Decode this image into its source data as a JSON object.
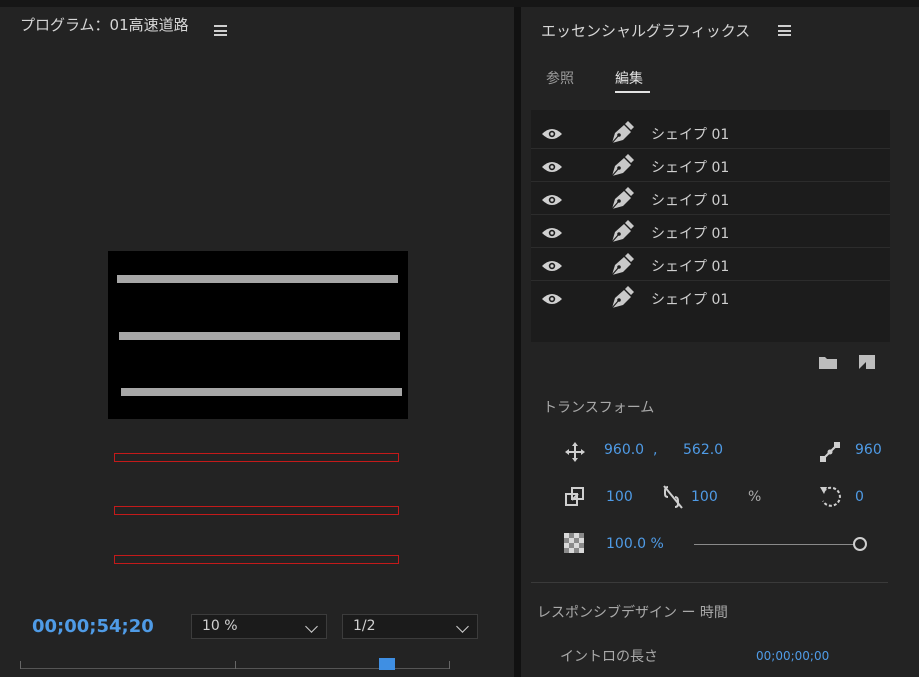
{
  "program_monitor": {
    "title": "プログラム：01高速道路",
    "timecode": "00;00;54;20",
    "zoom_select": "10 %",
    "resolution_select": "1/2"
  },
  "essential_graphics": {
    "title": "エッセンシャルグラフィックス",
    "tabs": [
      {
        "label": "参照",
        "active": false
      },
      {
        "label": "編集",
        "active": true
      }
    ],
    "layers": [
      {
        "name": "シェイプ 01"
      },
      {
        "name": "シェイプ 01"
      },
      {
        "name": "シェイプ 01"
      },
      {
        "name": "シェイプ 01"
      },
      {
        "name": "シェイプ 01"
      },
      {
        "name": "シェイプ 01"
      }
    ],
    "transform": {
      "title": "トランスフォーム",
      "position_x": "960.0",
      "position_sep": ",",
      "position_y": "562.0",
      "anchor_value": "960",
      "scale_width": "100",
      "scale_height": "100",
      "percent": "%",
      "rotation": "0",
      "opacity": "100.0 %",
      "opacity_fraction": 1.0
    },
    "responsive": {
      "title": "レスポンシブデザイン ー 時間",
      "intro_label": "イントロの長さ",
      "intro_value": "00;00;00;00"
    }
  },
  "colors": {
    "accent_blue": "#4f9be6",
    "panel_bg": "#232323",
    "overlay_red": "#c41a1a"
  }
}
